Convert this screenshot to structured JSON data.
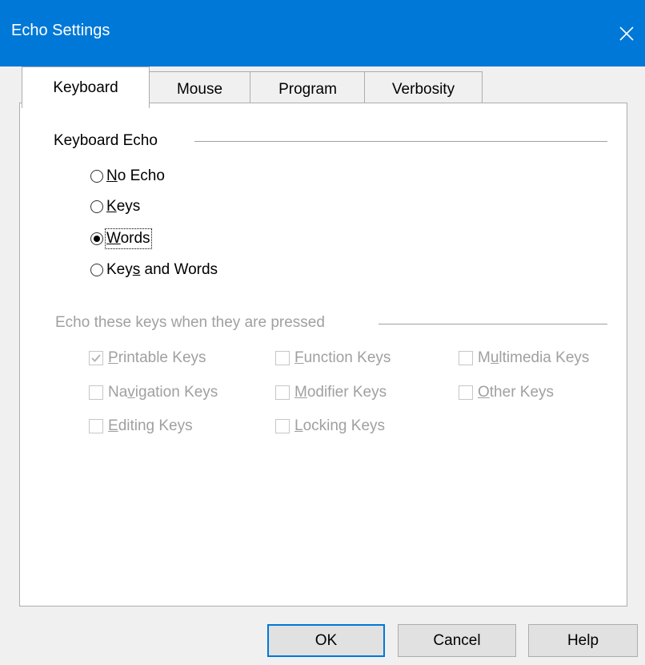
{
  "window": {
    "title": "Echo Settings"
  },
  "tabs": [
    {
      "label": "Keyboard"
    },
    {
      "label": "Mouse"
    },
    {
      "label": "Program"
    },
    {
      "label": "Verbosity"
    }
  ],
  "keyboard_echo": {
    "title": "Keyboard Echo",
    "options": [
      {
        "label_pre": "",
        "label_key": "N",
        "label_post": "o Echo",
        "selected": false
      },
      {
        "label_pre": "",
        "label_key": "K",
        "label_post": "eys",
        "selected": false
      },
      {
        "label_pre": "",
        "label_key": "W",
        "label_post": "ords",
        "selected": true
      },
      {
        "label_pre": "Key",
        "label_key": "s",
        "label_post": " and Words",
        "selected": false
      }
    ]
  },
  "echo_keys": {
    "title": "Echo these keys when they are pressed",
    "items": [
      {
        "label_pre": "",
        "label_key": "P",
        "label_post": "rintable Keys",
        "checked": true
      },
      {
        "label_pre": "",
        "label_key": "F",
        "label_post": "unction Keys",
        "checked": false
      },
      {
        "label_pre": "M",
        "label_key": "u",
        "label_post": "ltimedia Keys",
        "checked": false
      },
      {
        "label_pre": "Na",
        "label_key": "v",
        "label_post": "igation Keys",
        "checked": false
      },
      {
        "label_pre": "",
        "label_key": "M",
        "label_post": "odifier Keys",
        "checked": false
      },
      {
        "label_pre": "",
        "label_key": "O",
        "label_post": "ther Keys",
        "checked": false
      },
      {
        "label_pre": "",
        "label_key": "E",
        "label_post": "diting Keys",
        "checked": false
      },
      {
        "label_pre": "",
        "label_key": "L",
        "label_post": "ocking Keys",
        "checked": false
      }
    ]
  },
  "buttons": {
    "ok": "OK",
    "cancel": "Cancel",
    "help": "Help"
  },
  "colors": {
    "title_bar": "#0078d7",
    "disabled_text": "#a0a0a0",
    "default_button_border": "#0078d7"
  },
  "icons": {
    "close": "close-icon",
    "check": "check-icon"
  }
}
